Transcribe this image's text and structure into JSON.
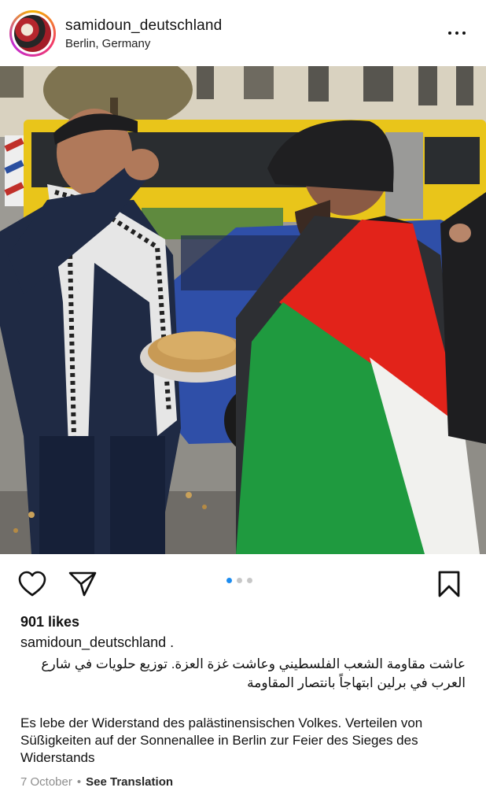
{
  "post": {
    "username": "samidoun_deutschland",
    "location": "Berlin, Germany"
  },
  "carousel": {
    "count": 3,
    "active_index": 0
  },
  "engagement": {
    "likes_text": "901 likes"
  },
  "caption": {
    "username": "samidoun_deutschland .",
    "arabic_line1": "عاشت مقاومة الشعب الفلسطيني وعاشت غزة العزة. توزيع حلويات في شارع",
    "arabic_line2": "العرب في برلين ابتهاجاً بانتصار المقاومة",
    "german": "Es lebe der Widerstand des palästinensischen Volkes. Verteilen von Süßigkeiten auf der Sonnenallee in Berlin zur Feier des Sieges des Widerstands"
  },
  "meta": {
    "date": "7 October",
    "separator": "•",
    "see_translation": "See Translation"
  },
  "icons": {
    "more": "more-options-icon",
    "like": "heart-icon",
    "share": "send-icon",
    "save": "bookmark-icon"
  },
  "colors": {
    "accent_blue": "#1c8cf0",
    "meta_gray": "#8e8e8e"
  }
}
